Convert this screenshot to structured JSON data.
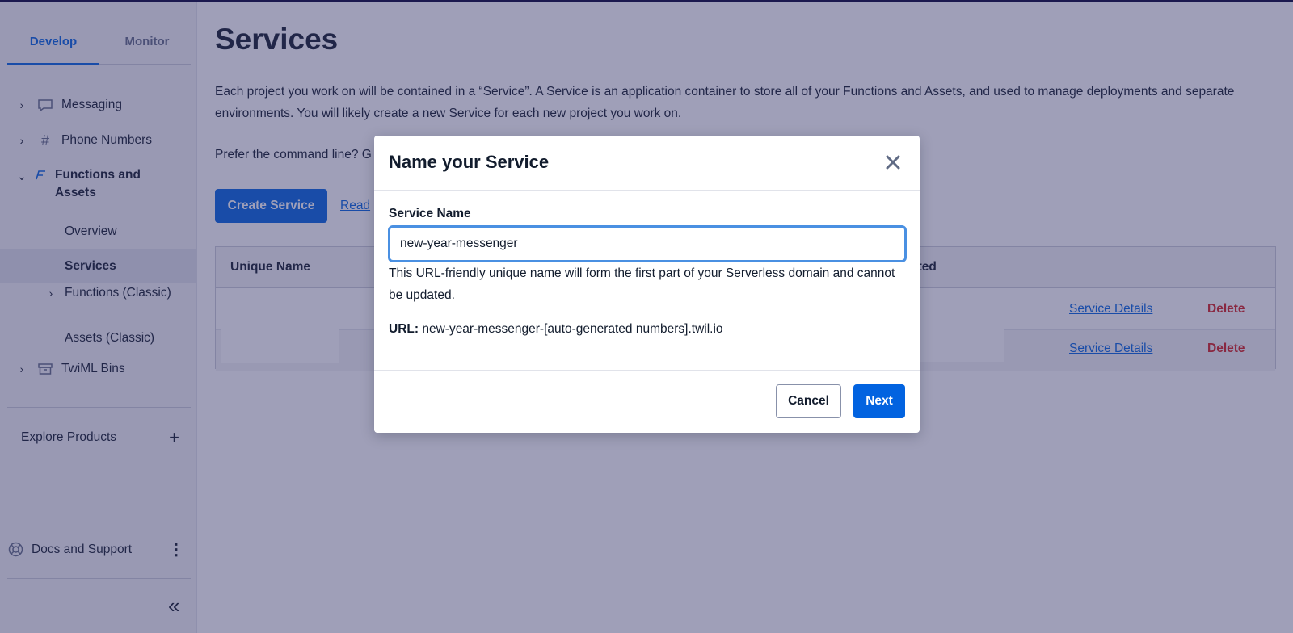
{
  "sidebar": {
    "tabs": [
      {
        "label": "Develop",
        "active": true
      },
      {
        "label": "Monitor",
        "active": false
      }
    ],
    "items": {
      "messaging": "Messaging",
      "phone_numbers": "Phone Numbers",
      "functions_and_assets": "Functions and Assets",
      "overview": "Overview",
      "services": "Services",
      "functions_classic": "Functions (Classic)",
      "assets_classic": "Assets (Classic)",
      "twiml_bins": "TwiML Bins"
    },
    "explore_products": "Explore Products",
    "docs_and_support": "Docs and Support"
  },
  "main": {
    "title": "Services",
    "description": "Each project you work on will be contained in a “Service”. A Service is an application container to store all of your Functions and Assets, and used to manage deployments and separate environments. You will likely create a new Service for each new project you work on.",
    "prefer_text": "Prefer the command line? G",
    "create_button": "Create Service",
    "read_link": "Read",
    "table": {
      "headers": [
        "Unique Name",
        "ated"
      ],
      "rows": [
        {
          "details_link": "Service Details",
          "delete": "Delete"
        },
        {
          "details_link": "Service Details",
          "delete": "Delete"
        }
      ]
    }
  },
  "modal": {
    "title": "Name your Service",
    "field_label": "Service Name",
    "input_value": "new-year-messenger",
    "help_text": "This URL-friendly unique name will form the first part of your Serverless domain and cannot be updated.",
    "url_label": "URL:",
    "url_value": "new-year-messenger-[auto-generated numbers].twil.io",
    "cancel_label": "Cancel",
    "next_label": "Next"
  },
  "colors": {
    "accent": "#0263e0",
    "danger": "#d61f1f",
    "overlay": "rgba(50, 50, 105, 0.47)"
  }
}
